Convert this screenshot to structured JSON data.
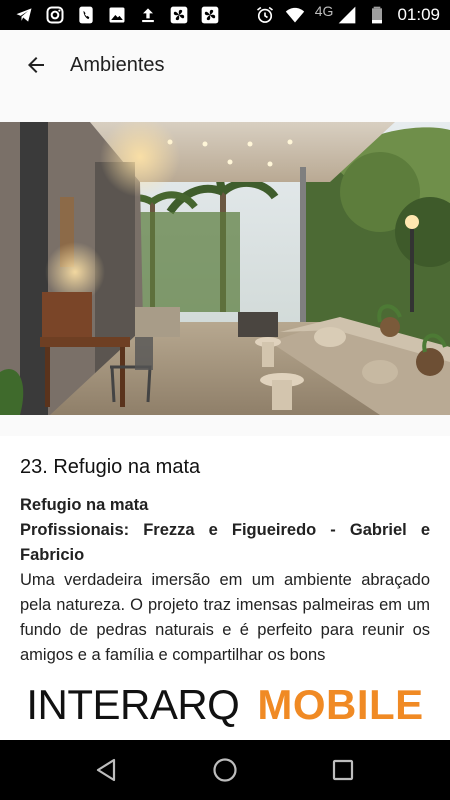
{
  "status_bar": {
    "network": "4G",
    "time": "01:09",
    "icons": [
      "telegram-icon",
      "instagram-icon",
      "phone-icon",
      "image-icon",
      "upload-icon",
      "fan-icon",
      "fan-icon",
      "alarm-icon",
      "wifi-icon",
      "signal-icon",
      "battery-icon"
    ]
  },
  "app_bar": {
    "title": "Ambientes",
    "back_icon": "arrow-left-icon"
  },
  "article": {
    "heading": "23. Refugio na mata",
    "subtitle": "Refugio na mata",
    "professionals": "Profissionais: Frezza e Figueiredo - Gabriel e Fabricio",
    "description": "Uma verdadeira imersão em um ambiente abraçado pela natureza. O projeto traz imensas palmeiras em um fundo de pedras naturais e é perfeito para reunir os amigos e a família e compartilhar os bons"
  },
  "banner": {
    "part1": "INTERARQ",
    "part2": "MOBILE",
    "accent_color": "#f08a24"
  },
  "nav_bar": {
    "icons": [
      "back-triangle-icon",
      "home-circle-icon",
      "recents-square-icon"
    ]
  }
}
